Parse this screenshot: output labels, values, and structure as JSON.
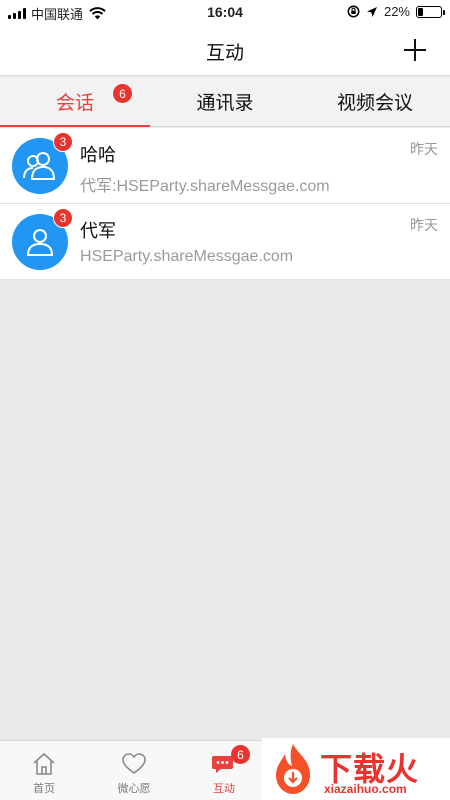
{
  "status_bar": {
    "carrier": "中国联通",
    "time": "16:04",
    "battery": "22%",
    "battery_level": 0.22
  },
  "nav": {
    "title": "互动",
    "add_icon": "plus-icon"
  },
  "tabs": [
    {
      "label": "会话",
      "badge": "6",
      "active": true
    },
    {
      "label": "通讯录",
      "active": false
    },
    {
      "label": "视频会议",
      "active": false
    }
  ],
  "conversations": [
    {
      "name": "哈哈",
      "time": "昨天",
      "preview": "代军:HSEParty.shareMessgae.com",
      "badge": "3",
      "avatar_icon": "group-avatar-icon"
    },
    {
      "name": "代军",
      "time": "昨天",
      "preview": "HSEParty.shareMessgae.com",
      "badge": "3",
      "avatar_icon": "user-avatar-icon"
    }
  ],
  "tab_bar": [
    {
      "label": "首页",
      "icon": "home-icon",
      "active": false
    },
    {
      "label": "微心愿",
      "icon": "heart-icon",
      "active": false
    },
    {
      "label": "互动",
      "icon": "chat-icon",
      "active": true,
      "badge": "6"
    }
  ],
  "watermark": {
    "text": "下载火",
    "sub": "xiazaihuo.com"
  },
  "colors": {
    "accent": "#e8413c",
    "badge": "#e8332f",
    "avatar": "#2196f3"
  }
}
